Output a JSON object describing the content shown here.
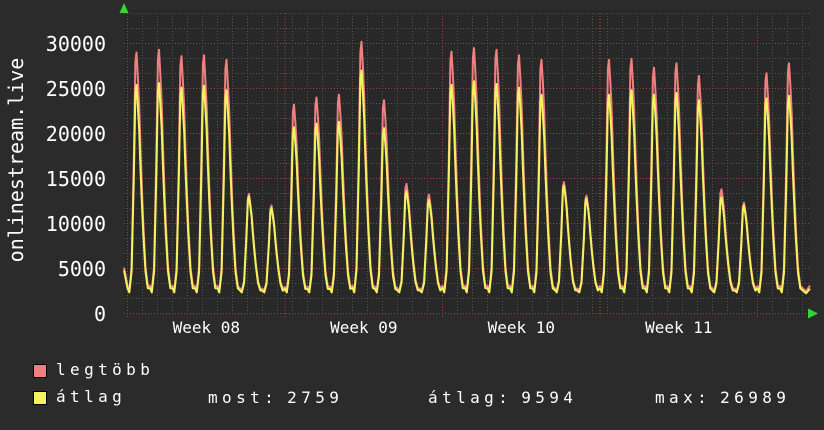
{
  "watermark": "onlinestream.live",
  "chart_data": {
    "type": "line",
    "title": "",
    "xlabel": "",
    "ylabel": "",
    "ylim": [
      0,
      33500
    ],
    "y_ticks": [
      0,
      5000,
      10000,
      15000,
      20000,
      25000,
      30000
    ],
    "x_tick_labels": [
      "Week 08",
      "Week 09",
      "Week 10",
      "Week 11"
    ],
    "grid": {
      "on": true,
      "minor_color": "#575757",
      "major_color": "#a34343",
      "bg": "#282828",
      "axis_arrow_color": "#33d633"
    },
    "legend_position": "bottom-left",
    "day_shape": [
      [
        0.0,
        0.02
      ],
      [
        0.08,
        0.0
      ],
      [
        0.18,
        0.1
      ],
      [
        0.28,
        0.55
      ],
      [
        0.35,
        0.96
      ],
      [
        0.4,
        1.0
      ],
      [
        0.46,
        0.9
      ],
      [
        0.52,
        0.78
      ],
      [
        0.57,
        0.62
      ],
      [
        0.63,
        0.45
      ],
      [
        0.7,
        0.28
      ],
      [
        0.8,
        0.1
      ],
      [
        0.9,
        0.02
      ]
    ],
    "series": [
      {
        "name": "legtöbb",
        "color": "#f08080",
        "base": 2550,
        "start_value": 5100,
        "end_value": 3100,
        "daily_peaks": [
          29000,
          29300,
          28600,
          28700,
          28200,
          13300,
          12000,
          23200,
          24000,
          24300,
          30200,
          23700,
          14400,
          13200,
          29100,
          29500,
          29300,
          28700,
          28200,
          14600,
          13100,
          28200,
          28300,
          27300,
          27800,
          26400,
          13800,
          12300,
          26700,
          27800
        ]
      },
      {
        "name": "átlag",
        "color": "#f3f35f",
        "base": 2350,
        "start_value": 4800,
        "end_value": 2759,
        "daily_peaks": [
          25400,
          25600,
          25100,
          25300,
          24800,
          13000,
          11700,
          20700,
          21100,
          21300,
          26989,
          20600,
          13600,
          12600,
          25400,
          25800,
          25500,
          25100,
          24300,
          14200,
          12800,
          24300,
          24800,
          24300,
          24500,
          23700,
          12900,
          12000,
          23900,
          24200
        ]
      }
    ],
    "legend": [
      {
        "label": "legtöbb",
        "color": "#f08080"
      },
      {
        "label": "átlag",
        "color": "#f3f35f"
      }
    ],
    "stats": [
      {
        "label": "most:",
        "value": "2759"
      },
      {
        "label": "átlag:",
        "value": "9594"
      },
      {
        "label": "max:",
        "value": "26989"
      }
    ]
  }
}
